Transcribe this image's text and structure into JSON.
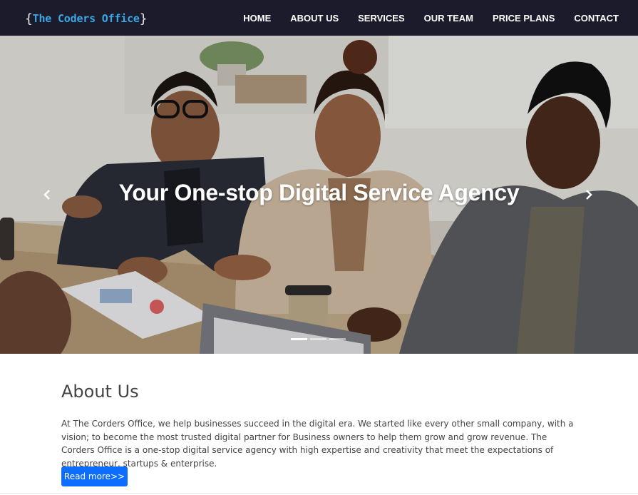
{
  "brand": {
    "open_brace": "{",
    "name": "The Coders Office",
    "close_brace": "}"
  },
  "nav": {
    "items": [
      {
        "label": "HOME"
      },
      {
        "label": "ABOUT US"
      },
      {
        "label": "SERVICES"
      },
      {
        "label": "OUR TEAM"
      },
      {
        "label": "PRICE PLANS"
      },
      {
        "label": "CONTACT"
      }
    ]
  },
  "hero": {
    "title": "Your One-stop Digital Service Agency",
    "prev_icon": "chevron-left-icon",
    "next_icon": "chevron-right-icon",
    "slide_count": 3,
    "active_slide": 1
  },
  "about": {
    "heading": "About Us",
    "text": "At The Corders Office, we help businesses succeed in the digital era. We started like every other small company, with a vision; to become the most trusted digital partner for Business owners to help them grow and grow revenue. The Corders Office is a one-stop digital service agency with high expertise and creativity that meet the expectations of entrepreneur, startups & enterprise.",
    "button_label": "Read more>>"
  },
  "colors": {
    "navbar_bg": "#1c1b2b",
    "brand_text": "#3aa7e6",
    "button_bg": "#0d6efd"
  }
}
